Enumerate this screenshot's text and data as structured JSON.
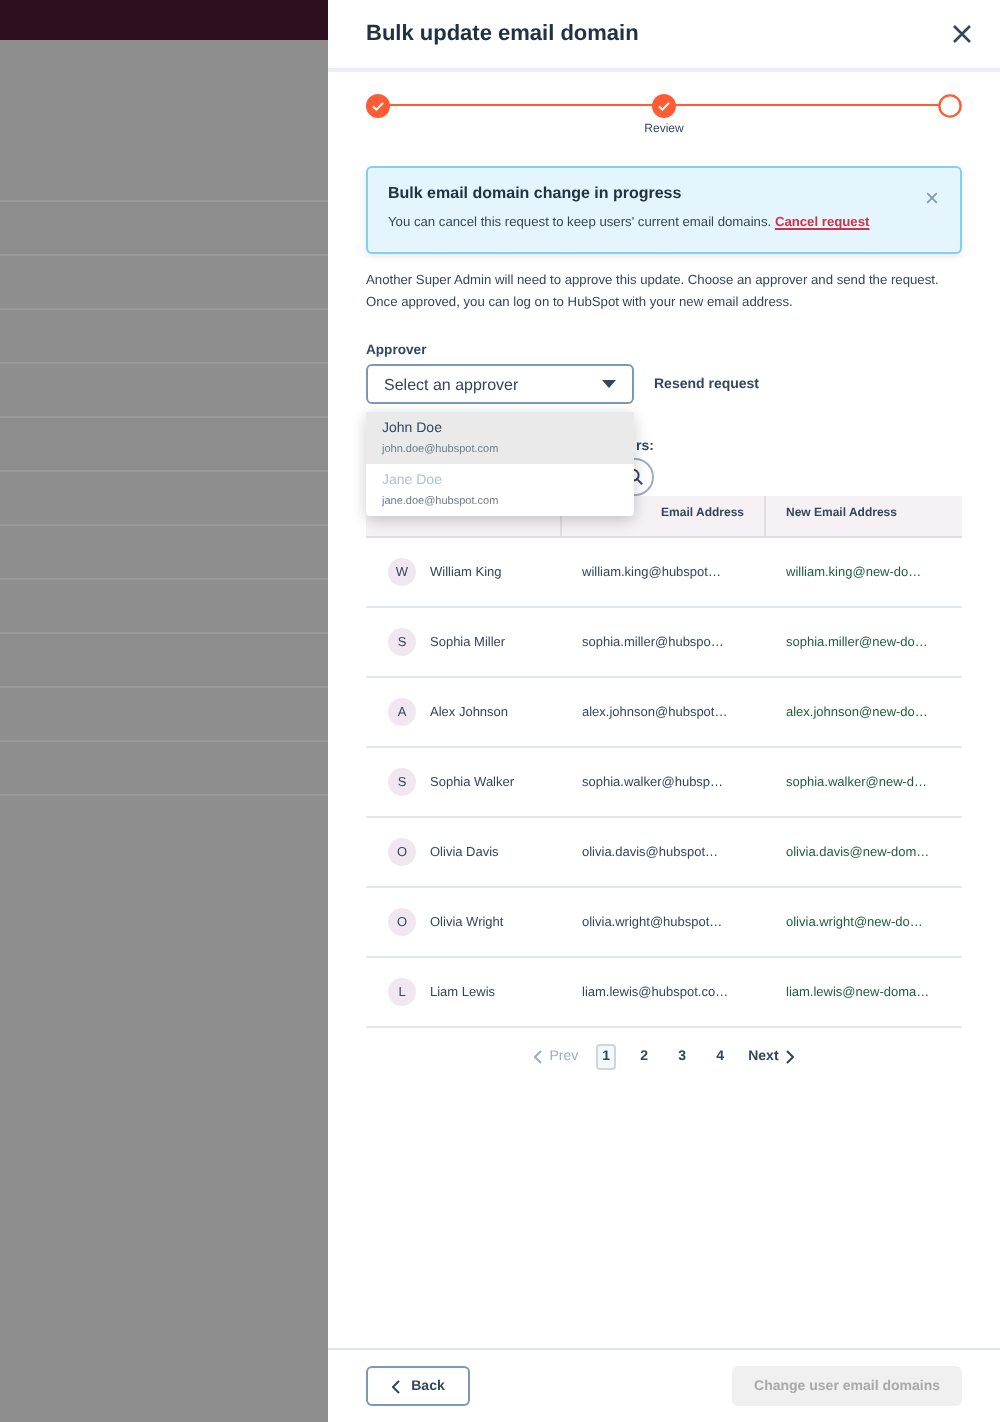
{
  "panel": {
    "title": "Bulk update email domain"
  },
  "steps": [
    {
      "done": true
    },
    {
      "done": true,
      "label": "Review"
    },
    {
      "done": false
    }
  ],
  "alert": {
    "title": "Bulk email domain change in progress",
    "text": "You can cancel this request to keep users' current email domains.",
    "link": "Cancel request"
  },
  "description": "Another Super Admin will need to approve this update. Choose an approver and send the request. Once approved, you can log on to HubSpot with your new email address.",
  "approver": {
    "label": "Approver",
    "placeholder": "Select an approver",
    "resend": "Resend request",
    "options": [
      {
        "name": "John Doe",
        "email": "john.doe@hubspot.com",
        "selected": true,
        "disabled": false
      },
      {
        "name": "Jane Doe",
        "email": "jane.doe@hubspot.com",
        "selected": false,
        "disabled": true
      }
    ]
  },
  "users_label": "rs:",
  "table": {
    "columns": [
      "Email Address",
      "New Email Address"
    ],
    "rows": [
      {
        "initial": "W",
        "name": "William King",
        "email": "william.king@hubspot…",
        "new_email": "william.king@new-do…"
      },
      {
        "initial": "S",
        "name": "Sophia Miller",
        "email": "sophia.miller@hubspo…",
        "new_email": "sophia.miller@new-do…"
      },
      {
        "initial": "A",
        "name": "Alex Johnson",
        "email": "alex.johnson@hubspot…",
        "new_email": "alex.johnson@new-do…"
      },
      {
        "initial": "S",
        "name": "Sophia Walker",
        "email": "sophia.walker@hubsp…",
        "new_email": "sophia.walker@new-d…"
      },
      {
        "initial": "O",
        "name": "Olivia Davis",
        "email": "olivia.davis@hubspot…",
        "new_email": "olivia.davis@new-dom…"
      },
      {
        "initial": "O",
        "name": "Olivia Wright",
        "email": "olivia.wright@hubspot…",
        "new_email": "olivia.wright@new-do…"
      },
      {
        "initial": "L",
        "name": "Liam Lewis",
        "email": "liam.lewis@hubspot.co…",
        "new_email": "liam.lewis@new-doma…"
      }
    ]
  },
  "pagination": {
    "prev": "Prev",
    "next": "Next",
    "pages": [
      {
        "label": "1",
        "selected": true
      },
      {
        "label": "2",
        "selected": false
      },
      {
        "label": "3",
        "selected": false
      },
      {
        "label": "4",
        "selected": false
      }
    ]
  },
  "footer": {
    "back": "Back",
    "submit": "Change user email domains",
    "submit_disabled": true
  }
}
